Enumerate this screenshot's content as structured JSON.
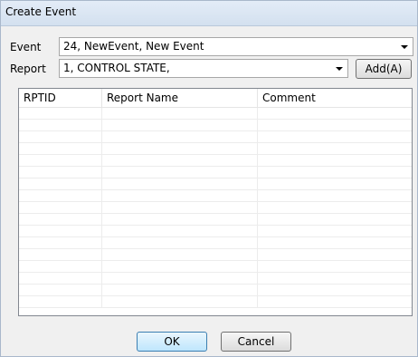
{
  "window": {
    "title": "Create Event"
  },
  "form": {
    "event_label": "Event",
    "event_value": "24, NewEvent, New Event",
    "report_label": "Report",
    "report_value": "1, CONTROL STATE,",
    "add_label": "Add(A)"
  },
  "table": {
    "columns": [
      "RPTID",
      "Report Name",
      "Comment"
    ],
    "rows": []
  },
  "footer": {
    "ok_label": "OK",
    "cancel_label": "Cancel"
  }
}
